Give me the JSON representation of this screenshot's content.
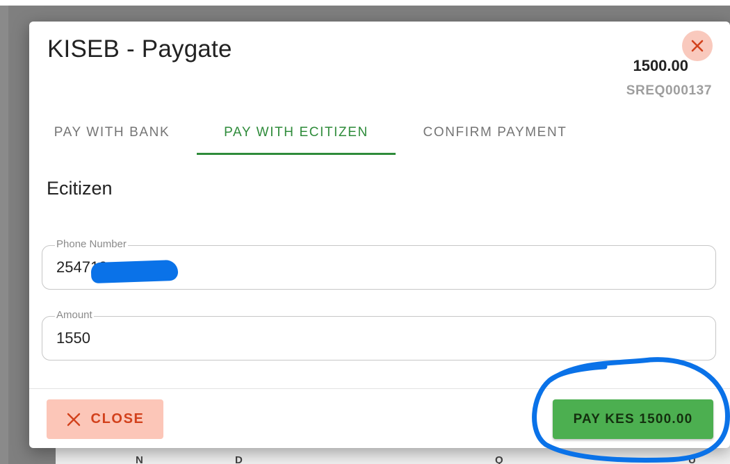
{
  "dialog": {
    "title": "KISEB - Paygate",
    "amount": "1500.00",
    "reference": "SREQ000137",
    "close_icon": "close-icon"
  },
  "tabs": [
    {
      "label": "PAY WITH BANK",
      "active": false
    },
    {
      "label": "PAY WITH ECITIZEN",
      "active": true
    },
    {
      "label": "CONFIRM PAYMENT",
      "active": false
    }
  ],
  "section": {
    "title": "Ecitizen"
  },
  "fields": {
    "phone": {
      "label": "Phone Number",
      "value": "254712"
    },
    "amount": {
      "label": "Amount",
      "value": "1550"
    }
  },
  "footer": {
    "close_label": "CLOSE",
    "pay_label": "PAY KES 1500.00"
  },
  "colors": {
    "accent": "#2e8b3a",
    "pay_button": "#4caf50",
    "close_button_bg": "#fcc6b8",
    "close_button_text": "#d2411c",
    "annotation": "#0a72e8"
  }
}
